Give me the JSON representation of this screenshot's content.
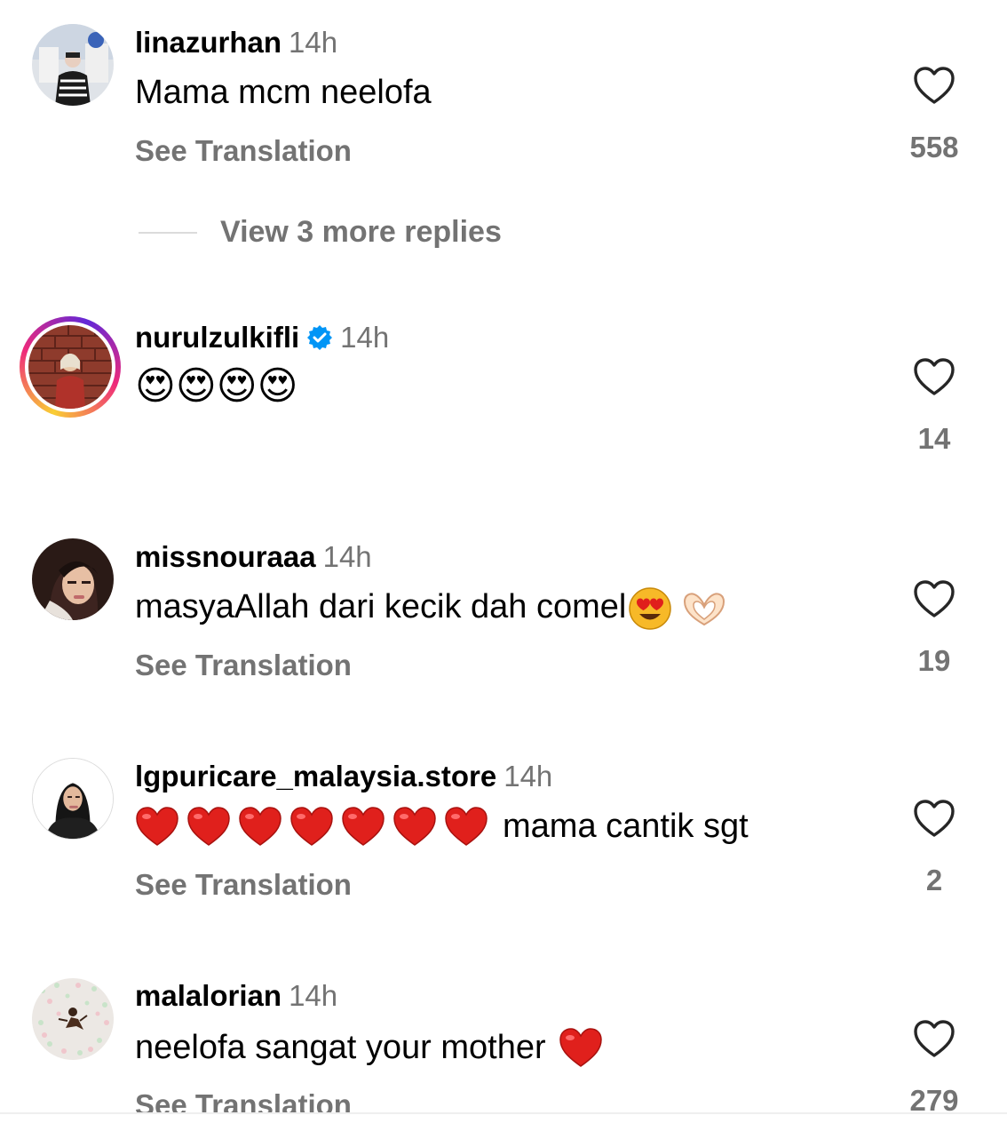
{
  "comments": [
    {
      "username": "linazurhan",
      "time": "14h",
      "text": "Mama mcm neelofa",
      "see_translation": "See Translation",
      "likes": "558"
    },
    {
      "username": "nurulzulkifli",
      "time": "14h",
      "verified": true,
      "text": "😍😍😍😍",
      "likes": "14"
    },
    {
      "username": "missnouraaa",
      "time": "14h",
      "text": "masyaAllah dari kecik dah comel",
      "see_translation": "See Translation",
      "likes": "19"
    },
    {
      "username": "lgpuricare_malaysia.store",
      "time": "14h",
      "text": "mama cantik sgt",
      "see_translation": "See Translation",
      "likes": "2"
    },
    {
      "username": "malalorian",
      "time": "14h",
      "text": "neelofa sangat your mother",
      "see_translation": "See Translation",
      "likes": "279"
    }
  ],
  "view_replies": "View 3 more replies",
  "icons": {
    "like": "heart-outline-icon",
    "verified": "verified-badge-icon"
  },
  "colors": {
    "secondary_text": "#737373",
    "verified_blue": "#0095f6",
    "heart_red": "#e0201c"
  }
}
